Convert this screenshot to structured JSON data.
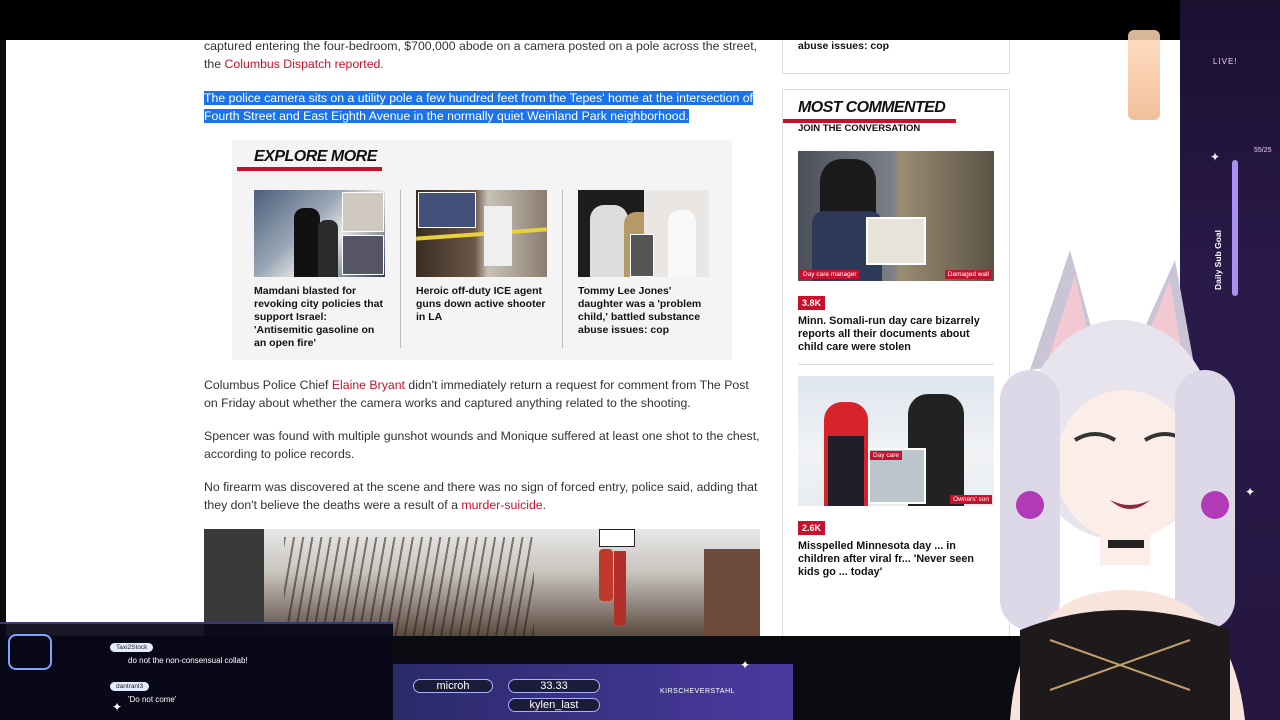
{
  "article": {
    "p1_a": "captured entering the four-bedroom, $700,000 abode on a camera posted on a pole across the street, the",
    "p1_link": "Columbus Dispatch reported.",
    "highlighted": "The police camera sits on a utility pole a few hundred feet from the Tepes' home at the intersection of Fourth Street and East Eighth Avenue in the normally quiet Weinland Park neighborhood.",
    "p3_a": "Columbus Police Chief ",
    "p3_link": "Elaine Bryant",
    "p3_b": " didn't immediately return a request for comment from The Post on Friday about whether the camera works and captured anything related to the shooting.",
    "p4": "Spencer was found with multiple gunshot wounds and Monique suffered at least one shot to the chest, according to police records.",
    "p5_a": "No firearm was discovered at the scene and there was no sign of forced entry, police said, adding that they don't believe the deaths were a result of a ",
    "p5_link": "murder-suicide",
    "p5_b": "."
  },
  "explore": {
    "heading": "EXPLORE MORE",
    "cards": [
      {
        "title": "Mamdani blasted for revoking city policies that support Israel: 'Antisemitic gasoline on an open fire'"
      },
      {
        "title": "Heroic off-duty ICE agent guns down active shooter in LA"
      },
      {
        "title": "Tommy Lee Jones' daughter was a 'problem child,' battled substance abuse issues: cop"
      }
    ]
  },
  "sidebar": {
    "prev_title_tail": "abuse issues: cop",
    "heading": "MOST COMMENTED",
    "sub": "JOIN THE CONVERSATION",
    "items": [
      {
        "count": "3.8K",
        "title": "Minn. Somali-run day care bizarrely reports all their documents about child care were stolen",
        "tag_left": "Day care manager",
        "tag_right": "Damaged wall"
      },
      {
        "count": "2.6K",
        "title": "Misspelled Minnesota day ... in children after viral fr... 'Never seen kids go ... today'",
        "tag_left": "Day care",
        "tag_right": "Owners' son"
      }
    ]
  },
  "overlay": {
    "live": "LIVE!",
    "goal_label": "Daily Sub Goal",
    "goal_value": "55/25",
    "chat": [
      {
        "user": "Taxi2Stock",
        "message": "do not the non-consensual collab!"
      },
      {
        "user": "dantranl3",
        "message": "'Do not come'"
      }
    ],
    "stat_1": "microh",
    "stat_2": "33.33",
    "stat_3": "kylen_last",
    "social": "KIRSCHEVERSTAHL"
  }
}
